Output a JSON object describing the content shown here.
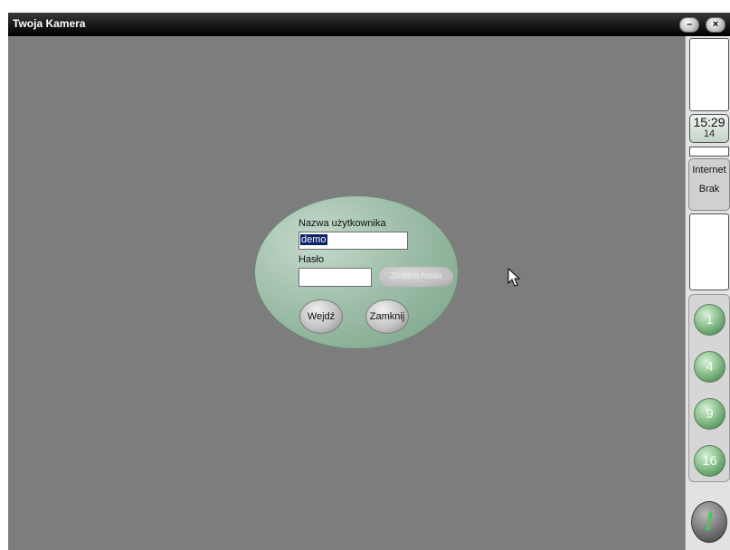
{
  "window": {
    "title": "Twoja Kamera",
    "minimize_glyph": "–",
    "close_glyph": "×"
  },
  "login": {
    "username_label": "Nazwa użytkownika",
    "username_value": "demo",
    "password_label": "Hasło",
    "password_value": "",
    "change_password_label": "Zmiana hasła",
    "enter_label": "Wejdź",
    "close_label": "Zamknij"
  },
  "sidebar": {
    "clock_time": "15:29",
    "clock_seconds": "14",
    "internet_label": "Internet",
    "internet_status": "Brak",
    "view_buttons": [
      "1",
      "4",
      "9",
      "16"
    ],
    "alert_glyph": "!"
  },
  "colors": {
    "background": "#7d7d7d",
    "oval_green": "#9fbea9",
    "view_button_green": "#9ccc9e",
    "alert_green": "#39d14a",
    "selection_blue": "#0a246a"
  }
}
